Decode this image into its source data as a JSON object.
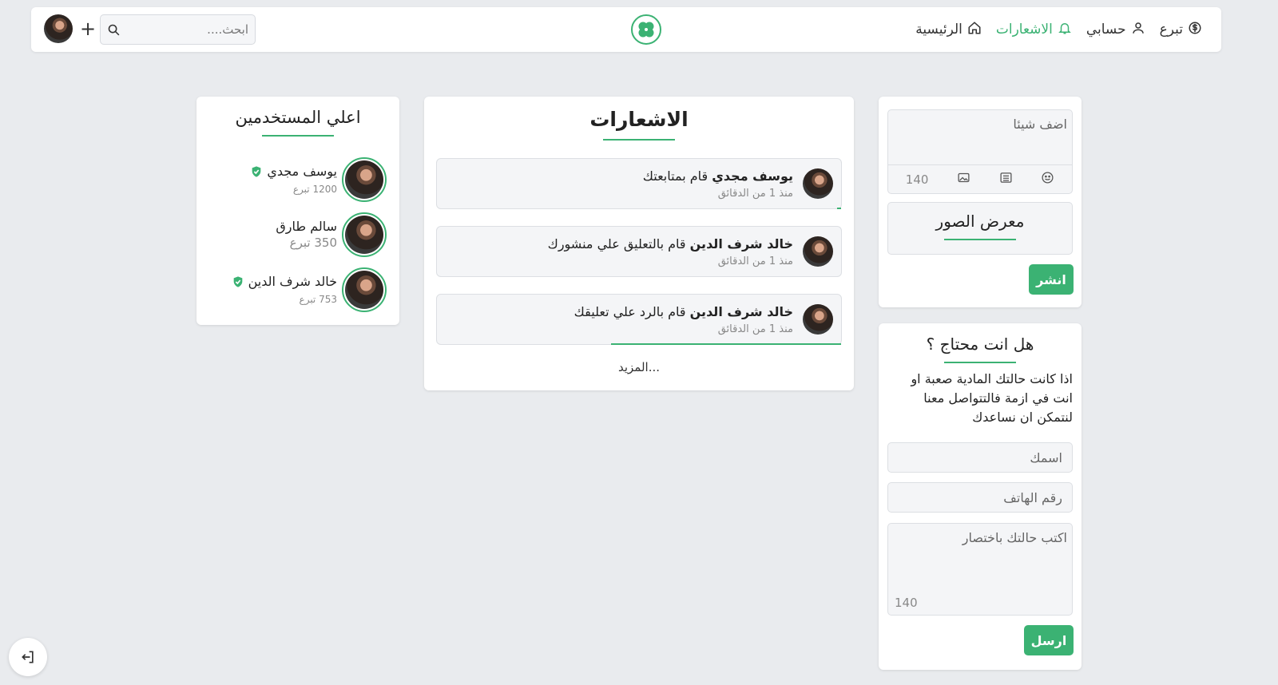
{
  "nav": {
    "links": [
      {
        "label": "الرئيسية",
        "icon": "home-icon"
      },
      {
        "label": "الاشعارات",
        "icon": "bell-icon",
        "active": true
      },
      {
        "label": "حسابي",
        "icon": "user-icon"
      },
      {
        "label": "تبرع",
        "icon": "dollar-icon"
      }
    ],
    "search_placeholder": "ابحث....",
    "add_label": "+"
  },
  "colors": {
    "accent": "#3bb273",
    "background": "#e9ebee"
  },
  "top_users": {
    "title": "اعلي المستخدمين",
    "users": [
      {
        "name": "يوسف مجدي",
        "meta": "1200 تبرع",
        "verified": true
      },
      {
        "name": "سالم طارق",
        "meta": "350 تبرع",
        "verified": false
      },
      {
        "name": "خالد شرف الدين",
        "meta": "753 تبرع",
        "verified": true
      }
    ]
  },
  "notifications": {
    "title": "الاشعارات",
    "items": [
      {
        "user": "يوسف مجدي",
        "action": "قام بمتابعتك",
        "time": "منذ 1 من الدقائق",
        "progress": 0.01
      },
      {
        "user": "خالد شرف الدين",
        "action": "قام بالتعليق علي منشورك",
        "time": "منذ 1 من الدقائق",
        "progress": 0
      },
      {
        "user": "خالد شرف الدين",
        "action": "قام بالرد علي تعليقك",
        "time": "منذ 1 من الدقائق",
        "progress": 0.57
      }
    ],
    "more_label": "...المزيد"
  },
  "composer": {
    "placeholder": "اضف شيئا",
    "counter": "140",
    "gallery_title": "معرض الصور",
    "publish_label": "انشر"
  },
  "help": {
    "title": "هل انت محتاج ؟",
    "text": "اذا كانت حالتك المادية صعبة او انت في ازمة فالتتواصل معنا لنتمكن ان نساعدك",
    "name_placeholder": "اسمك",
    "phone_placeholder": "رقم الهاتف",
    "message_placeholder": "اكتب حالتك باختصار",
    "counter": "140",
    "send_label": "ارسل"
  }
}
